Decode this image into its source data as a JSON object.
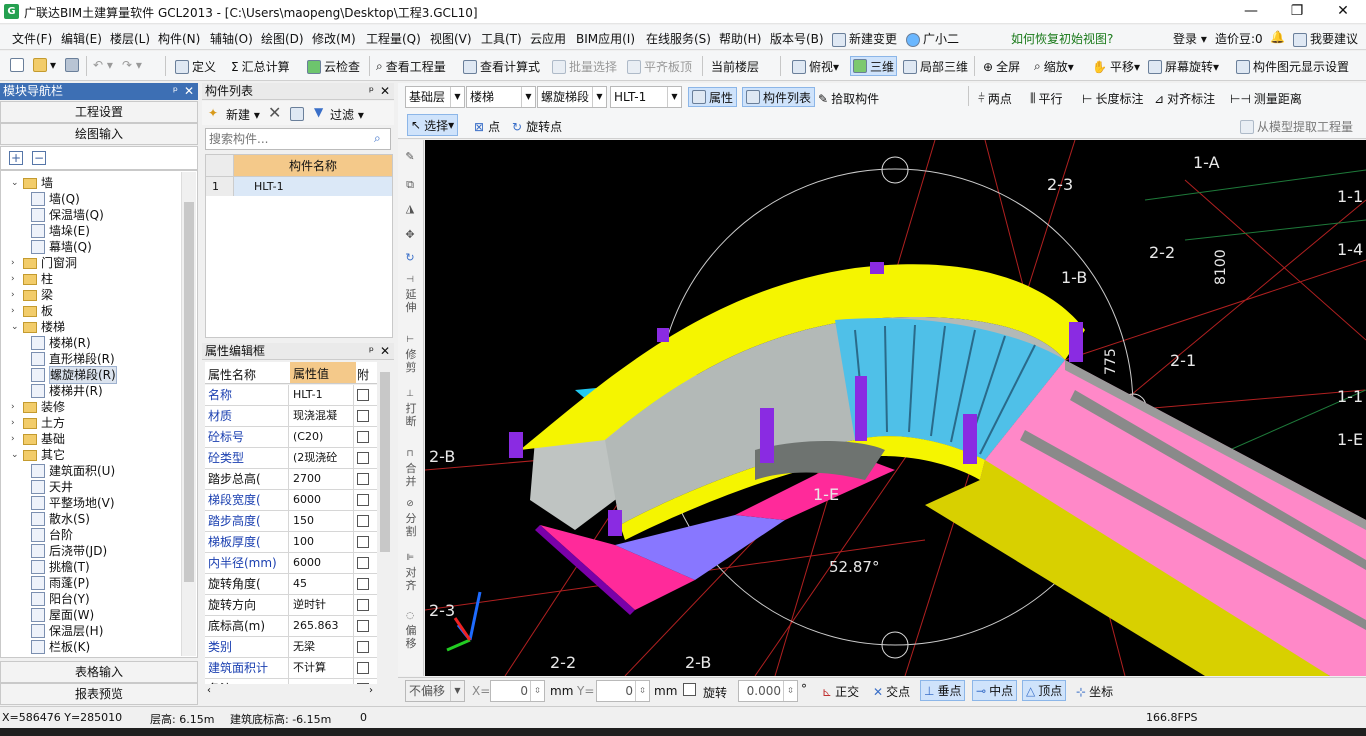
{
  "window": {
    "app_icon": "G",
    "title": "广联达BIM土建算量软件 GCL2013 - [C:\\Users\\maopeng\\Desktop\\工程3.GCL10]",
    "minimize": "—",
    "maximize": "❐",
    "close": "✕"
  },
  "menubar": {
    "items": [
      "文件(F)",
      "编辑(E)",
      "楼层(L)",
      "构件(N)",
      "辅轴(O)",
      "绘图(D)",
      "修改(M)",
      "工程量(Q)",
      "视图(V)",
      "工具(T)",
      "云应用",
      "BIM应用(I)",
      "在线服务(S)",
      "帮助(H)",
      "版本号(B)",
      "新建变更",
      "广小二"
    ],
    "help_link": "如何恢复初始视图?",
    "login": "登录",
    "price_bean": "造价豆:0",
    "suggest": "我要建议"
  },
  "toolbar1": {
    "define": "定义",
    "sum_calc": "汇总计算",
    "cloud_check": "云检查",
    "view_quantity": "查看工程量",
    "view_formula": "查看计算式",
    "batch_select": "批量选择",
    "level_slab": "平齐板顶",
    "current_floor": "当前楼层",
    "top_view": "俯视",
    "three_d": "三维",
    "local_3d": "局部三维",
    "fullscreen": "全屏",
    "zoom": "缩放",
    "pan": "平移",
    "screen_rotate": "屏幕旋转",
    "element_display": "构件图元显示设置"
  },
  "nav_panel": {
    "header": "模块导航栏",
    "pin": "ᵖ",
    "close": "✕",
    "project_settings": "工程设置",
    "drawing_input": "绘图输入",
    "add": "+",
    "remove": "−",
    "table_input": "表格输入",
    "report_preview": "报表预览",
    "tree": [
      {
        "label": "墙",
        "level": 0,
        "open": true,
        "folder": true
      },
      {
        "label": "墙(Q)",
        "level": 1
      },
      {
        "label": "保温墙(Q)",
        "level": 1
      },
      {
        "label": "墙垛(E)",
        "level": 1
      },
      {
        "label": "幕墙(Q)",
        "level": 1
      },
      {
        "label": "门窗洞",
        "level": 0,
        "folder": true
      },
      {
        "label": "柱",
        "level": 0,
        "folder": true
      },
      {
        "label": "梁",
        "level": 0,
        "folder": true
      },
      {
        "label": "板",
        "level": 0,
        "folder": true
      },
      {
        "label": "楼梯",
        "level": 0,
        "open": true,
        "folder": true
      },
      {
        "label": "楼梯(R)",
        "level": 1
      },
      {
        "label": "直形梯段(R)",
        "level": 1
      },
      {
        "label": "螺旋梯段(R)",
        "level": 1,
        "selected": true
      },
      {
        "label": "楼梯井(R)",
        "level": 1
      },
      {
        "label": "装修",
        "level": 0,
        "folder": true
      },
      {
        "label": "土方",
        "level": 0,
        "folder": true
      },
      {
        "label": "基础",
        "level": 0,
        "folder": true
      },
      {
        "label": "其它",
        "level": 0,
        "open": true,
        "folder": true
      },
      {
        "label": "建筑面积(U)",
        "level": 1
      },
      {
        "label": "天井",
        "level": 1
      },
      {
        "label": "平整场地(V)",
        "level": 1
      },
      {
        "label": "散水(S)",
        "level": 1
      },
      {
        "label": "台阶",
        "level": 1
      },
      {
        "label": "后浇带(JD)",
        "level": 1
      },
      {
        "label": "挑檐(T)",
        "level": 1
      },
      {
        "label": "雨蓬(P)",
        "level": 1
      },
      {
        "label": "阳台(Y)",
        "level": 1
      },
      {
        "label": "屋面(W)",
        "level": 1
      },
      {
        "label": "保温层(H)",
        "level": 1
      },
      {
        "label": "栏板(K)",
        "level": 1
      }
    ]
  },
  "component_list": {
    "header": "构件列表",
    "new": "新建",
    "filter": "过滤",
    "search_placeholder": "搜索构件...",
    "column": "构件名称",
    "rows": [
      {
        "index": "1",
        "name": "HLT-1"
      }
    ]
  },
  "property_panel": {
    "header": "属性编辑框",
    "col_name": "属性名称",
    "col_value": "属性值",
    "col_extra": "附加",
    "rows": [
      {
        "name": "名称",
        "value": "HLT-1",
        "blue": true
      },
      {
        "name": "材质",
        "value": "现浇混凝",
        "blue": true
      },
      {
        "name": "砼标号",
        "value": "(C20)",
        "blue": true
      },
      {
        "name": "砼类型",
        "value": "(2现浇砼",
        "blue": true
      },
      {
        "name": "踏步总高(",
        "value": "2700",
        "blue": false
      },
      {
        "name": "梯段宽度(",
        "value": "6000",
        "blue": true
      },
      {
        "name": "踏步高度(",
        "value": "150",
        "blue": true
      },
      {
        "name": "梯板厚度(",
        "value": "100",
        "blue": true
      },
      {
        "name": "内半径(mm)",
        "value": "6000",
        "blue": true
      },
      {
        "name": "旋转角度(",
        "value": "45",
        "blue": false
      },
      {
        "name": "旋转方向",
        "value": "逆时针",
        "blue": false
      },
      {
        "name": "底标高(m)",
        "value": "265.863",
        "blue": false
      },
      {
        "name": "类别",
        "value": "无梁",
        "blue": true
      },
      {
        "name": "建筑面积计",
        "value": "不计算",
        "blue": true
      },
      {
        "name": "备注",
        "value": "",
        "blue": false
      }
    ]
  },
  "layer_toolbar": {
    "base_layer": "基础层",
    "category": "楼梯",
    "type": "螺旋梯段",
    "element": "HLT-1",
    "attribute": "属性",
    "component_list": "构件列表",
    "pick_component": "拾取构件",
    "two_points": "两点",
    "parallel": "平行",
    "length_label": "长度标注",
    "aligned_label": "对齐标注",
    "measure": "测量距离",
    "select": "选择",
    "point": "点",
    "rotate_point": "旋转点",
    "extract": "从模型提取工程量"
  },
  "side_tools": [
    "延伸",
    "修剪",
    "打断",
    "合并",
    "分割",
    "对齐",
    "偏移"
  ],
  "viewport": {
    "axis_labels": [
      "1-A",
      "2-3",
      "1-1",
      "2-2",
      "1-4",
      "1-B",
      "8100",
      "775",
      "2-1",
      "1-1",
      "1-E",
      "2-B",
      "1-E",
      "2-3",
      "2-2",
      "2-B"
    ],
    "angle_label": "52.87°"
  },
  "bottom_toolbar": {
    "no_offset": "不偏移",
    "x_label": "X=",
    "x_value": "0",
    "y_label": "Y=",
    "y_value": "0",
    "unit": "mm",
    "rotate": "旋转",
    "rotate_value": "0.000",
    "degree": "°",
    "orthogonal": "正交",
    "intersection": "交点",
    "perpendicular": "垂点",
    "midpoint": "中点",
    "vertex": "顶点",
    "coordinate": "坐标"
  },
  "statusbar": {
    "coords": "X=586476 Y=285010",
    "floor_height": "层高: 6.15m",
    "base_elevation": "建筑底标高: -6.15m",
    "value": "0",
    "fps": "166.8FPS"
  },
  "colors": {
    "nav_header": "#3d6fb4",
    "viewport_bg": "#000000",
    "stair_yellow": "#f5f500",
    "stair_pink": "#ff88c8",
    "stair_cyan": "#22c8f0",
    "marker_purple": "#8a2be2"
  }
}
